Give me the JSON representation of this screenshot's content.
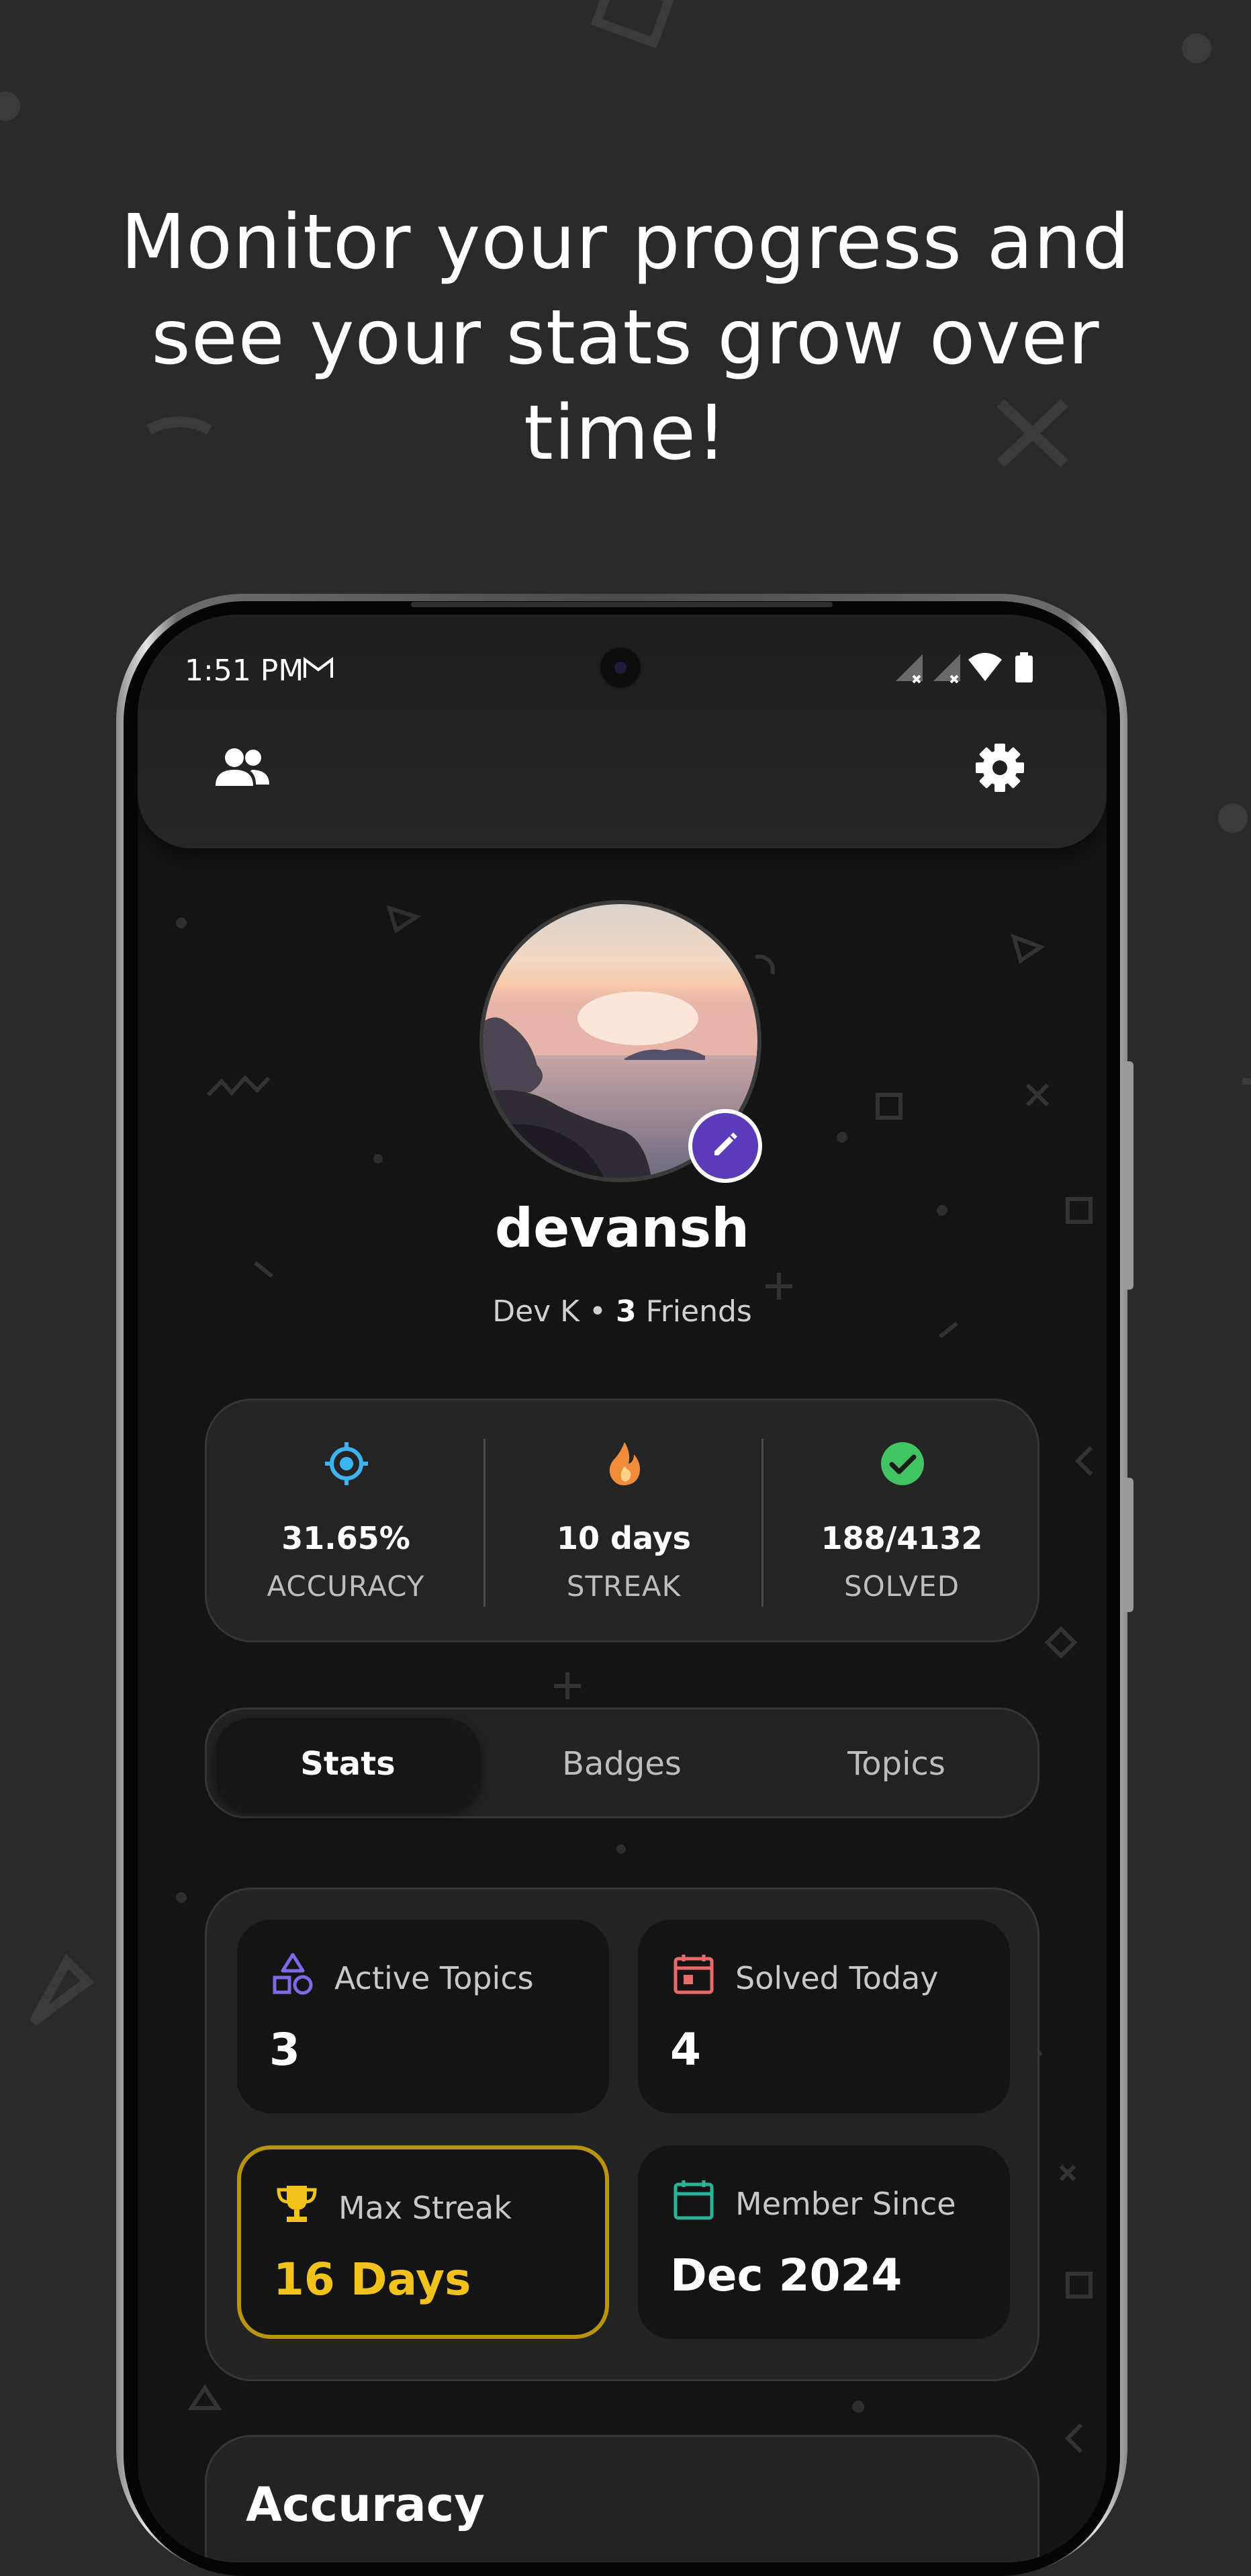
{
  "headline": {
    "line1": "Monitor your progress and",
    "line2": "see your stats grow over",
    "line3": "time!"
  },
  "status_bar": {
    "time": "1:51 PM",
    "icons": [
      "gmail-icon",
      "signal-icon",
      "signal-icon",
      "wifi-icon",
      "battery-icon"
    ]
  },
  "app_bar": {
    "left_icon": "friends-icon",
    "right_icon": "settings-gear-icon"
  },
  "profile": {
    "username": "devansh",
    "display_name": "Dev K",
    "separator": " • ",
    "friends_count": "3",
    "friends_label": " Friends"
  },
  "summary_stats": [
    {
      "icon": "target-icon",
      "value": "31.65%",
      "label": "ACCURACY",
      "color": "#3db5f0"
    },
    {
      "icon": "fire-icon",
      "value": "10 days",
      "label": "STREAK",
      "color": "#f08c3a"
    },
    {
      "icon": "check-circle-icon",
      "value": "188/4132",
      "label": "SOLVED",
      "color": "#43c463"
    }
  ],
  "tabs": [
    {
      "label": "Stats",
      "active": true
    },
    {
      "label": "Badges",
      "active": false
    },
    {
      "label": "Topics",
      "active": false
    }
  ],
  "stat_tiles": [
    {
      "icon": "shapes-icon",
      "label": "Active Topics",
      "value": "3",
      "color": "#7b6be6"
    },
    {
      "icon": "calendar-icon",
      "label": "Solved Today",
      "value": "4",
      "color": "#e86a6a"
    },
    {
      "icon": "trophy-icon",
      "label": "Max Streak",
      "value": "16 Days",
      "color": "#f1c21b",
      "highlighted": true
    },
    {
      "icon": "calendar-outline-icon",
      "label": "Member Since",
      "value": "Dec 2024",
      "color": "#2bb39a"
    }
  ],
  "next_section": {
    "title": "Accuracy"
  },
  "colors": {
    "background": "#2a2a2a",
    "screen": "#141414",
    "accent_purple": "#5a3bb8",
    "gold": "#f1c21b"
  }
}
